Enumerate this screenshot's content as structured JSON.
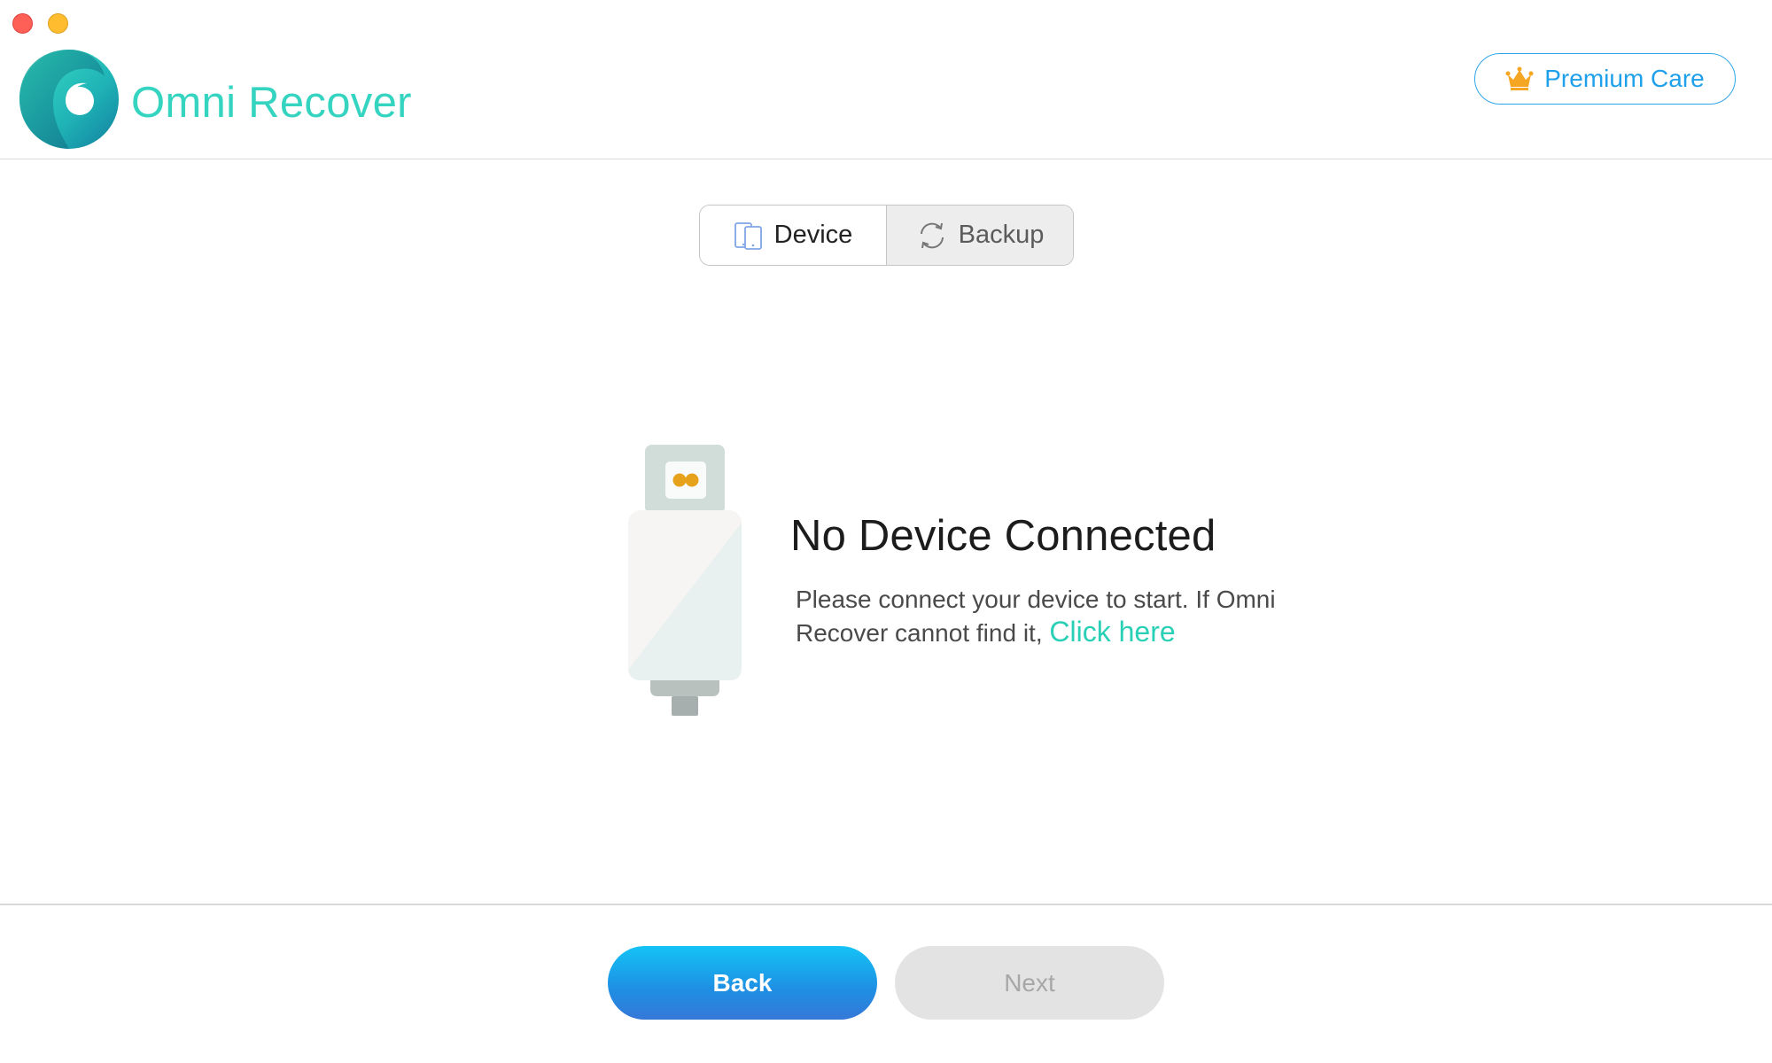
{
  "window": {
    "close_color": "#fe5f57",
    "minimize_color": "#febc2e"
  },
  "header": {
    "app_title": "Omni Recover",
    "premium_label": "Premium Care",
    "brand_color": "#35d4c1",
    "premium_color": "#1fa0ea"
  },
  "tabs": [
    {
      "label": "Device",
      "icon": "device-icon",
      "selected": true
    },
    {
      "label": "Backup",
      "icon": "sync-icon",
      "selected": false
    }
  ],
  "status": {
    "title": "No Device Connected",
    "body": "Please connect your device to start. If Omni Recover cannot find it,",
    "link": "Click here",
    "link_color": "#2ad0b6"
  },
  "footer": {
    "back_label": "Back",
    "next_label": "Next",
    "next_enabled": false
  }
}
